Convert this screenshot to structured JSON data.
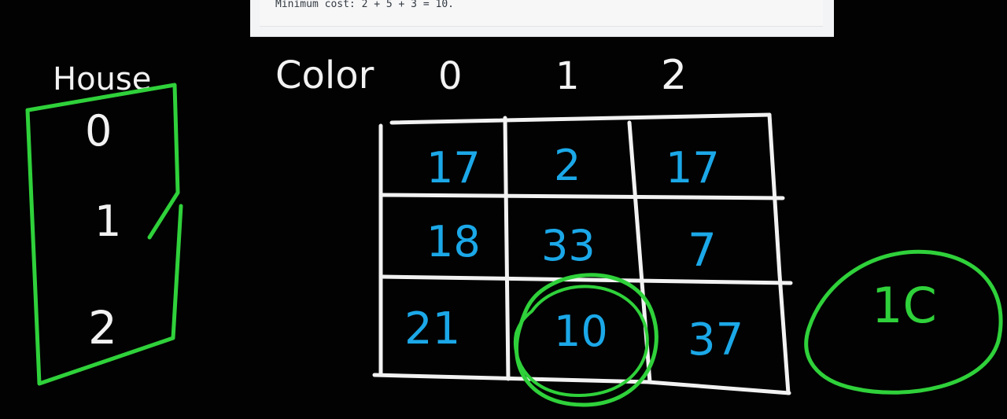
{
  "top_panel": {
    "text": "Minimum cost: 2 + 5 + 3 = 10."
  },
  "labels": {
    "house": "House",
    "color": "Color"
  },
  "houses": [
    "0",
    "1",
    "2"
  ],
  "colors": [
    "0",
    "1",
    "2"
  ],
  "cost_grid": [
    [
      "17",
      "2",
      "17"
    ],
    [
      "18",
      "33",
      "7"
    ],
    [
      "21",
      "10",
      "37"
    ]
  ],
  "side_note": "1C",
  "style": {
    "background": "#020202",
    "chalk": "#f2f2f2",
    "cost_blue": "#1ba8e8",
    "marker_green": "#2fd13a"
  }
}
